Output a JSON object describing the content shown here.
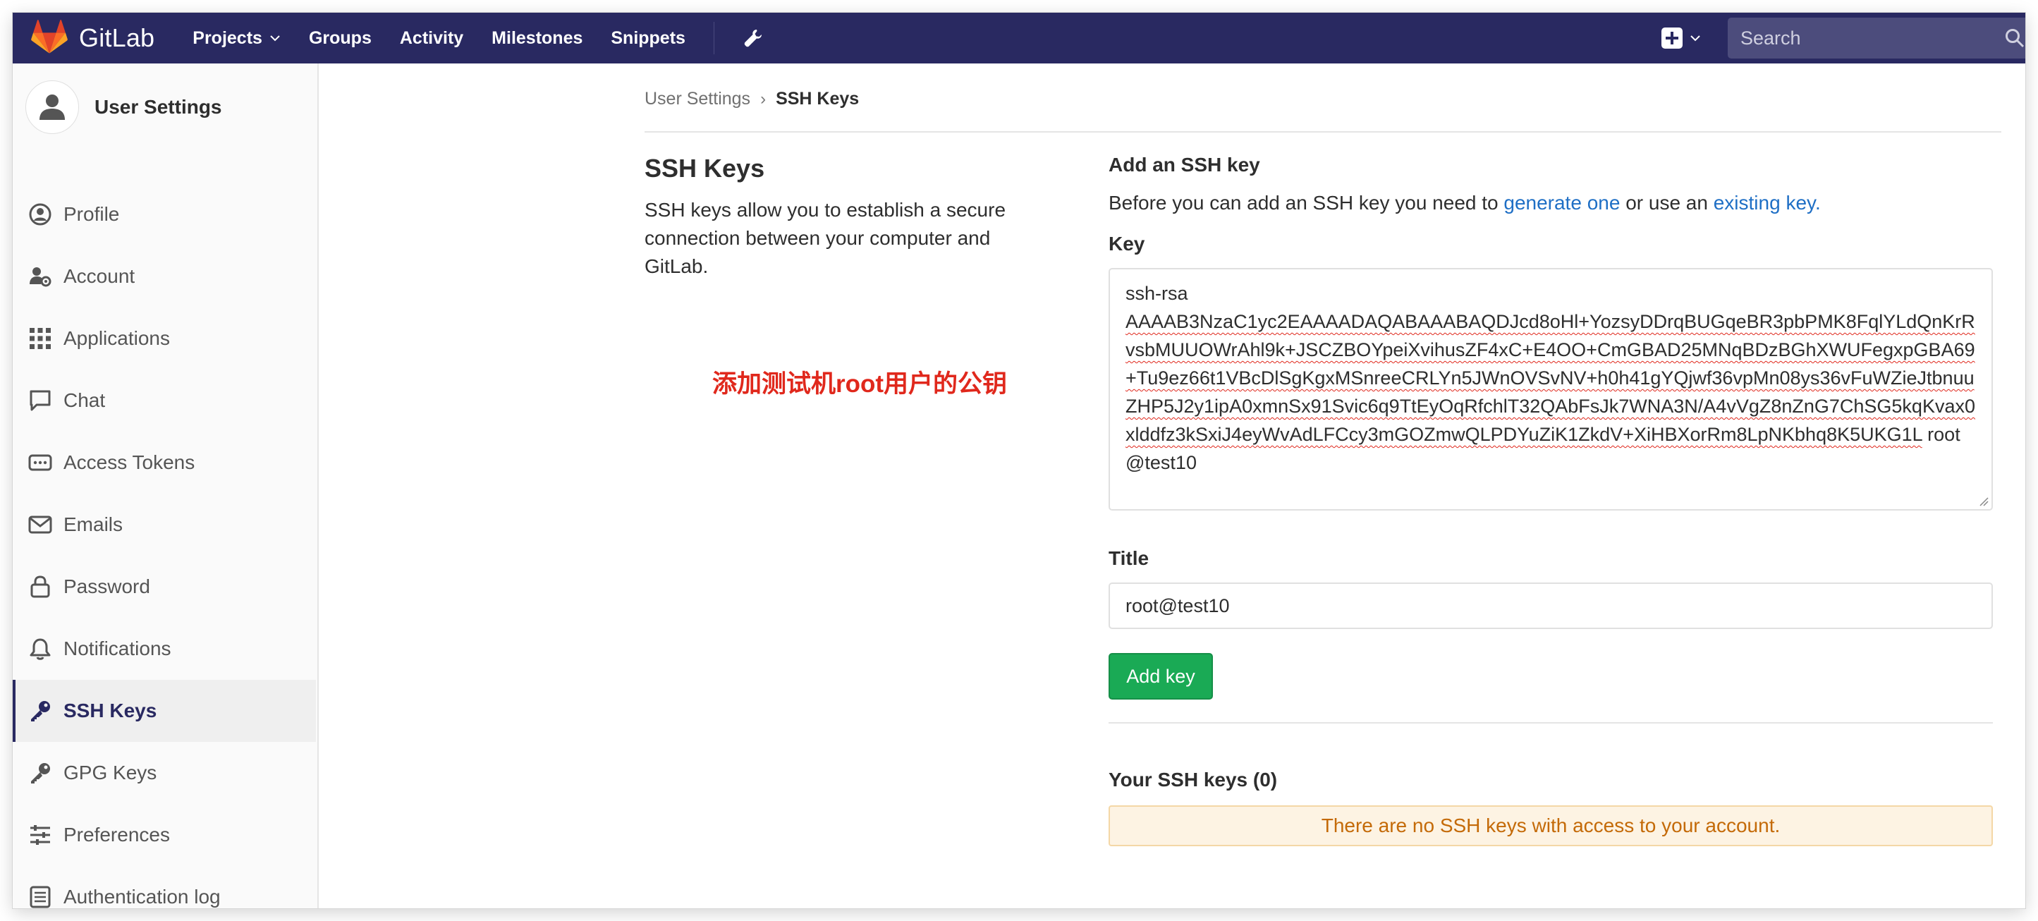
{
  "navbar": {
    "brand": "GitLab",
    "links": [
      "Projects",
      "Groups",
      "Activity",
      "Milestones",
      "Snippets"
    ],
    "search_placeholder": "Search"
  },
  "sidebar": {
    "title": "User Settings",
    "items": [
      {
        "label": "Profile",
        "icon": "profile-icon"
      },
      {
        "label": "Account",
        "icon": "account-icon"
      },
      {
        "label": "Applications",
        "icon": "applications-icon"
      },
      {
        "label": "Chat",
        "icon": "chat-icon"
      },
      {
        "label": "Access Tokens",
        "icon": "access-tokens-icon"
      },
      {
        "label": "Emails",
        "icon": "envelope-icon"
      },
      {
        "label": "Password",
        "icon": "lock-icon"
      },
      {
        "label": "Notifications",
        "icon": "bell-icon"
      },
      {
        "label": "SSH Keys",
        "icon": "key-icon",
        "active": true
      },
      {
        "label": "GPG Keys",
        "icon": "key-icon"
      },
      {
        "label": "Preferences",
        "icon": "preferences-icon"
      },
      {
        "label": "Authentication log",
        "icon": "log-icon"
      }
    ]
  },
  "breadcrumb": {
    "parent": "User Settings",
    "current": "SSH Keys"
  },
  "section": {
    "title": "SSH Keys",
    "description": "SSH keys allow you to establish a secure connection between your computer and GitLab."
  },
  "annotation": "添加测试机root用户的公钥",
  "form": {
    "heading": "Add an SSH key",
    "desc_prefix": "Before you can add an SSH key you need to ",
    "generate_link": "generate one",
    "desc_middle": " or use an ",
    "existing_link": "existing key.",
    "key_label": "Key",
    "key_type": "ssh-rsa",
    "key_body": "AAAAB3NzaC1yc2EAAAADAQABAAABAQDJcd8oHl+YozsyDDrqBUGqeBR3pbPMK8FqlYLdQnKrRvsbMUUOWrAhl9k+JSCZBOYpeiXvihusZF4xC+E4OO+CmGBAD25MNqBDzBGhXWUFegxpGBA69+Tu9ez66t1VBcDlSgKgxMSnreeCRLYn5JWnOVSvNV+h0h41gYQjwf36vpMn08ys36vFuWZieJtbnuuZHP5J2y1ipA0xmnSx91Svic6q9TtEyOqRfchlT32QAbFsJk7WNA3N/A4vVgZ8nZnG7ChSG5kqKvax0xlddfz3kSxiJ4eyWvAdLFCcy3mGOZmwQLPDYuZiK1ZkdV+XiHBXorRm8LpNKbhq8K5UKG1L",
    "key_comment": " root@test10",
    "title_label": "Title",
    "title_value": "root@test10",
    "submit_label": "Add key",
    "your_keys_label": "Your SSH keys (0)",
    "empty_message": "There are no SSH keys with access to your account."
  },
  "colors": {
    "navbar_bg": "#292961",
    "primary_button": "#1aaa55",
    "link": "#1f6fc5",
    "annotation": "#e0281c",
    "warning_text": "#c46a08",
    "warning_bg": "#fdf3e3"
  }
}
